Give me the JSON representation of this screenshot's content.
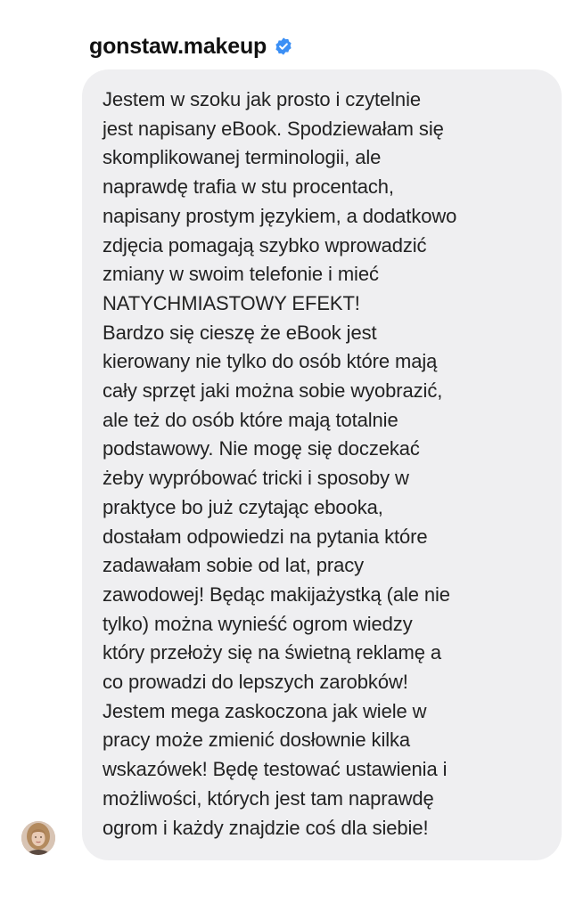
{
  "conversation": {
    "username": "gonstaw.makeup",
    "verified": true,
    "verified_icon": "verified-badge-icon",
    "accent_color": "#3b8ff5",
    "bubble_color": "#efeff1"
  },
  "message": {
    "paragraphs": [
      {
        "lines": [
          "Jestem w szoku jak prosto i czytelnie",
          "jest napisany eBook. Spodziewałam się",
          "skomplikowanej terminologii, ale",
          "naprawdę trafia w stu procentach,",
          "napisany prostym językiem, a dodatkowo",
          "zdjęcia pomagają szybko wprowadzić",
          "zmiany w swoim telefonie i mieć",
          "NATYCHMIASTOWY EFEKT!"
        ]
      },
      {
        "lines": [
          "Bardzo się cieszę że eBook jest",
          "kierowany nie tylko do osób które mają",
          "cały sprzęt jaki można sobie wyobrazić,",
          "ale też do osób które mają totalnie",
          "podstawowy. Nie mogę się doczekać",
          "żeby wypróbować tricki i sposoby w",
          "praktyce bo już czytając ebooka,",
          "dostałam odpowiedzi na pytania które",
          "zadawałam sobie od lat, pracy",
          "zawodowej! Będąc makijażystką (ale nie",
          "tylko) można wynieść ogrom wiedzy",
          "który przełoży się na świetną reklamę a",
          "co prowadzi do lepszych zarobków!"
        ]
      },
      {
        "lines": [
          "Jestem mega zaskoczona jak wiele w",
          "pracy może zmienić dosłownie kilka",
          "wskazówek! Będę testować ustawienia i",
          "możliwości, których jest tam naprawdę",
          "ogrom i każdy znajdzie coś dla siebie!"
        ]
      }
    ]
  },
  "sender": {
    "avatar_icon": "profile-photo-avatar"
  }
}
